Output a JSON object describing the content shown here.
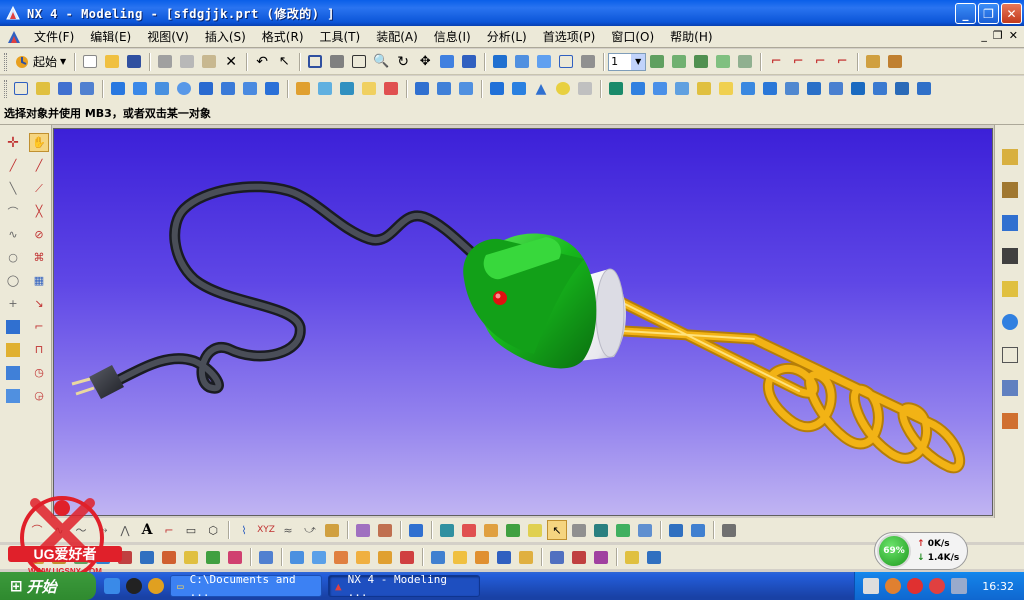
{
  "window": {
    "title": "NX 4 - Modeling - [sfdgjjk.prt  (修改的) ]",
    "controls": [
      "_",
      "❐",
      "✕"
    ]
  },
  "menu": {
    "items": [
      "文件(F)",
      "编辑(E)",
      "视图(V)",
      "插入(S)",
      "格式(R)",
      "工具(T)",
      "装配(A)",
      "信息(I)",
      "分析(L)",
      "首选项(P)",
      "窗口(O)",
      "帮助(H)"
    ],
    "mdi_controls": [
      "_",
      "❐",
      "✕"
    ]
  },
  "toolbar": {
    "start_label": "起始",
    "layer_value": "1"
  },
  "prompt": "选择对象并使用 MB3，或者双击某一对象",
  "bottom": {
    "text_tool": "A"
  },
  "netmeter": {
    "percent": "69%",
    "up_rate": "0K/s",
    "down_rate": "1.4K/s"
  },
  "taskbar": {
    "start_label": "开始",
    "tasks": [
      {
        "label": "C:\\Documents and ...",
        "active": false
      },
      {
        "label": "NX 4 - Modeling ...",
        "active": true
      }
    ],
    "clock": "16:32"
  },
  "watermark": {
    "brand": "UG爱好者",
    "url": "WWW.UGSNX.COM"
  },
  "colors": {
    "body_green": "#17b91d",
    "coil_yellow": "#f2b315",
    "cable_gray": "#3a3d44",
    "sleeve_white": "#f4f4f4",
    "indicator_red": "#e01010"
  }
}
